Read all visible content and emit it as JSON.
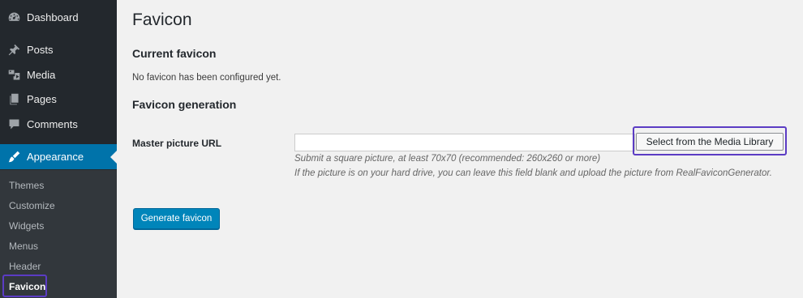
{
  "sidebar": {
    "items": [
      {
        "label": "Dashboard",
        "icon": "dashboard-icon"
      },
      {
        "label": "Posts",
        "icon": "pin-icon"
      },
      {
        "label": "Media",
        "icon": "media-icon"
      },
      {
        "label": "Pages",
        "icon": "pages-icon"
      },
      {
        "label": "Comments",
        "icon": "comment-icon"
      },
      {
        "label": "Appearance",
        "icon": "brush-icon",
        "current": true
      }
    ],
    "submenu": [
      {
        "label": "Themes"
      },
      {
        "label": "Customize"
      },
      {
        "label": "Widgets"
      },
      {
        "label": "Menus"
      },
      {
        "label": "Header"
      },
      {
        "label": "Favicon",
        "active": true
      }
    ],
    "colors": {
      "bg": "#23282d",
      "current": "#0073aa",
      "highlight": "#5b3cc4"
    }
  },
  "main": {
    "title": "Favicon",
    "current_heading": "Current favicon",
    "current_note": "No favicon has been configured yet.",
    "generation_heading": "Favicon generation",
    "master_label": "Master picture URL",
    "url_value": "",
    "media_button": "Select from the Media Library",
    "desc1": "Submit a square picture, at least 70x70 (recommended: 260x260 or more)",
    "desc2": "If the picture is on your hard drive, you can leave this field blank and upload the picture from RealFaviconGenerator.",
    "generate_button": "Generate favicon"
  }
}
